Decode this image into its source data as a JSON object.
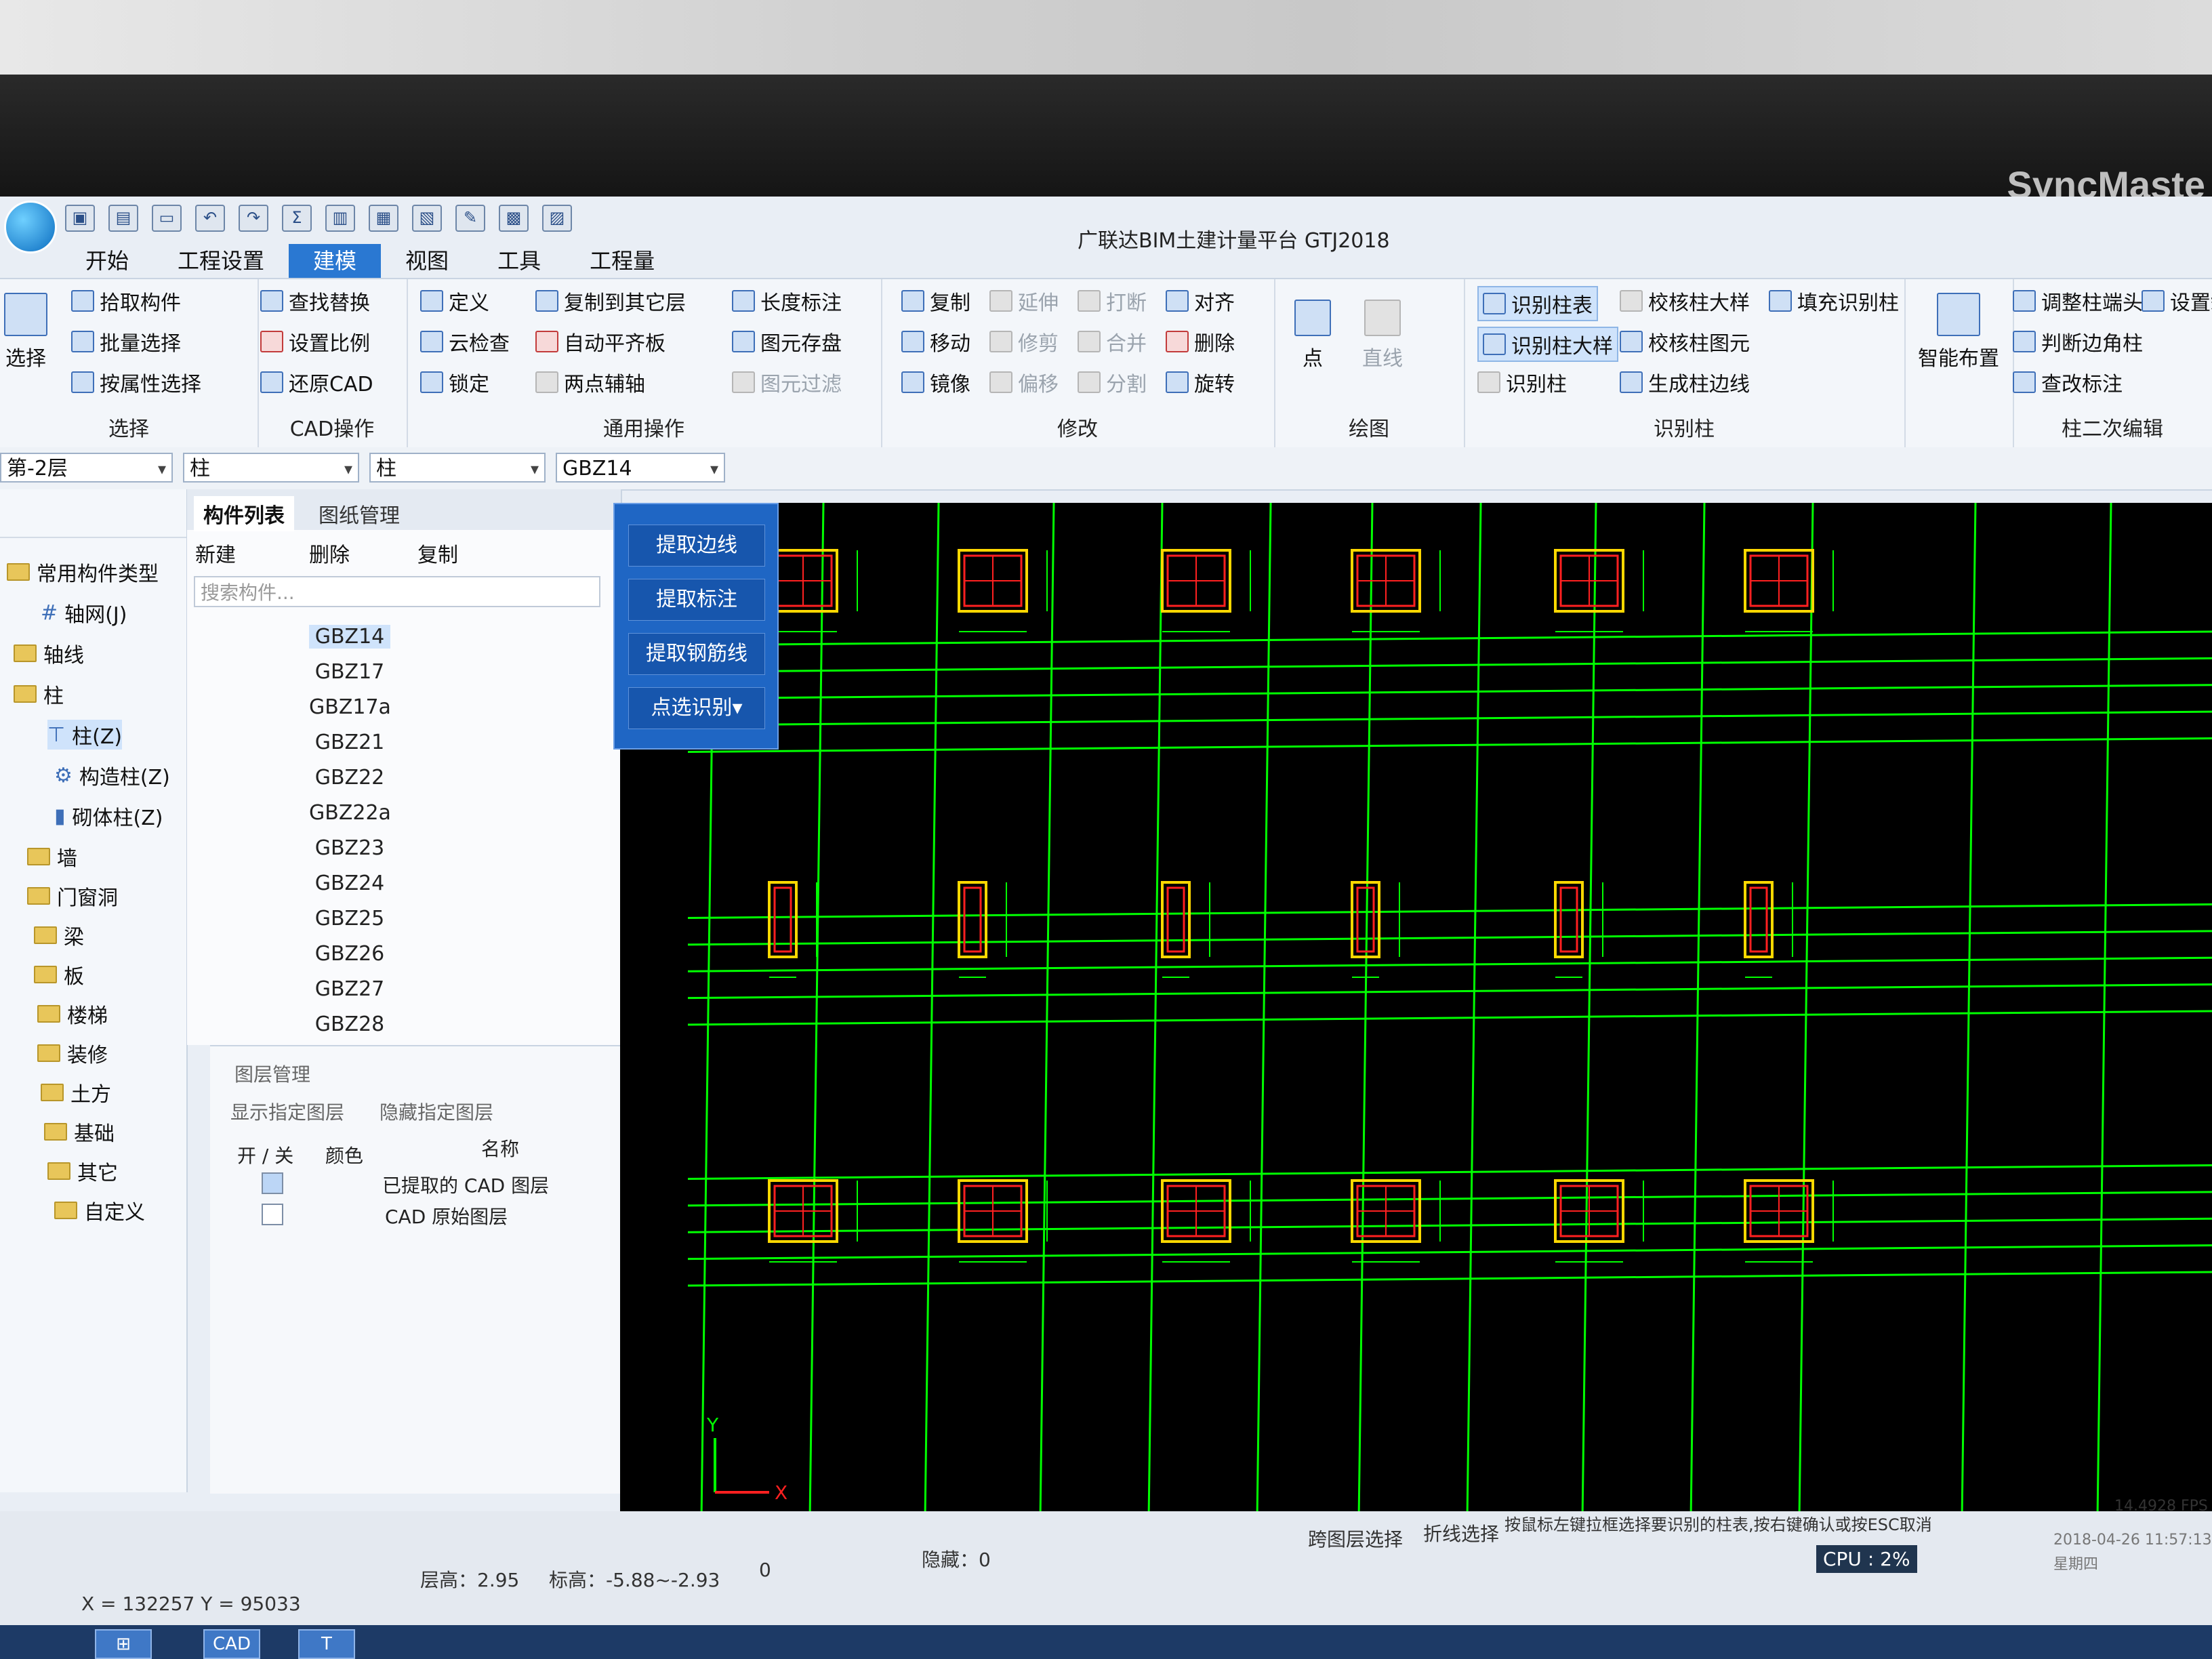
{
  "brand": "SyncMaste",
  "window_title": "广联达BIM土建计量平台 GTJ2018",
  "tabs": [
    "开始",
    "工程设置",
    "建模",
    "视图",
    "工具",
    "工程量"
  ],
  "ribbon": {
    "select": {
      "label": "选择",
      "title": "选择"
    },
    "pick": {
      "pick_component": "拾取构件",
      "batch_select": "批量选择",
      "attr_select": "按属性选择"
    },
    "cad": {
      "find_replace": "查找替换",
      "set_scale": "设置比例",
      "restore_cad": "还原CAD",
      "title": "CAD操作"
    },
    "common": {
      "define": "定义",
      "cloud_check": "云检查",
      "lock": "锁定",
      "copy_to_floor": "复制到其它层",
      "auto_flat": "自动平齐板",
      "two_point_axis": "两点辅轴",
      "length_mark": "长度标注",
      "elem_save": "图元存盘",
      "elem_filter": "图元过滤",
      "title": "通用操作"
    },
    "modify": {
      "copy": "复制",
      "move": "移动",
      "mirror": "镜像",
      "extend": "延伸",
      "trim": "修剪",
      "offset": "偏移",
      "break": "打断",
      "merge": "合并",
      "split": "分割",
      "align": "对齐",
      "delete": "删除",
      "rotate": "旋转",
      "title": "修改"
    },
    "draw": {
      "point": "点",
      "line": "直线",
      "title": "绘图"
    },
    "identify": {
      "id_table": "识别柱表",
      "id_large_table": "识别柱大样",
      "id_column": "识别柱",
      "check_large": "校核柱大样",
      "check_elem": "校核柱图元",
      "gen_edge": "生成柱边线",
      "fill_id": "填充识别柱",
      "title": "识别柱"
    },
    "smart": {
      "label": "智能布置"
    },
    "second": {
      "adjust_head": "调整柱端头",
      "judge_corner": "判断边角柱",
      "view_mark": "查改标注",
      "settings": "设置斜",
      "title": "柱二次编辑"
    }
  },
  "selectors": {
    "floor": "第-2层",
    "type1": "柱",
    "type2": "柱",
    "component": "GBZ14"
  },
  "tree": {
    "common_types": "常用构件类型",
    "axis_net": "轴网(J)",
    "axis": "轴线",
    "column": "柱",
    "column_z": "柱(Z)",
    "struct_column": "构造柱(Z)",
    "masonry_column": "砌体柱(Z)",
    "wall": "墙",
    "door_window": "门窗洞",
    "beam": "梁",
    "slab": "板",
    "stair": "楼梯",
    "decor": "装修",
    "earth": "土方",
    "foundation": "基础",
    "other": "其它",
    "custom": "自定义"
  },
  "component_list": {
    "tab_list": "构件列表",
    "tab_drawing": "图纸管理",
    "new": "新建",
    "delete": "删除",
    "copy": "复制",
    "search_placeholder": "搜索构件...",
    "items": [
      "GBZ14",
      "GBZ17",
      "GBZ17a",
      "GBZ21",
      "GBZ22",
      "GBZ22a",
      "GBZ23",
      "GBZ24",
      "GBZ25",
      "GBZ26",
      "GBZ27",
      "GBZ28"
    ]
  },
  "layer_panel": {
    "title": "图层管理",
    "show_layer": "显示指定图层",
    "hide_layer": "隐藏指定图层",
    "col_onoff": "开 / 关",
    "col_color": "颜色",
    "col_name": "名称",
    "row1": "已提取的 CAD 图层",
    "row2": "CAD 原始图层"
  },
  "identify_panel": {
    "extract_edge": "提取边线",
    "extract_mark": "提取标注",
    "extract_rebar": "提取钢筋线",
    "point_identify": "点选识别▾"
  },
  "status": {
    "coords": "X = 132257 Y = 95033",
    "floor_height": "层高：2.95",
    "elevation": "标高：-5.88~-2.93",
    "zero": "0",
    "hidden": "隐藏：0",
    "cross_layer": "跨图层选择",
    "polyline_select": "折线选择",
    "hint": "按鼠标左键拉框选择要识别的柱表,按右键确认或按ESC取消",
    "fps": "14.4928 FPS",
    "cpu": "CPU : 2%",
    "datetime": "2018-04-26 11:57:13",
    "weekday": "星期四"
  },
  "taskbar": {
    "cad": "CAD"
  },
  "axis_labels": {
    "x": "X",
    "y": "Y"
  },
  "colors": {
    "accent": "#2a78d2",
    "cad_green": "#00ff00",
    "cad_red": "#ff2020",
    "cad_yellow": "#ffd800"
  }
}
